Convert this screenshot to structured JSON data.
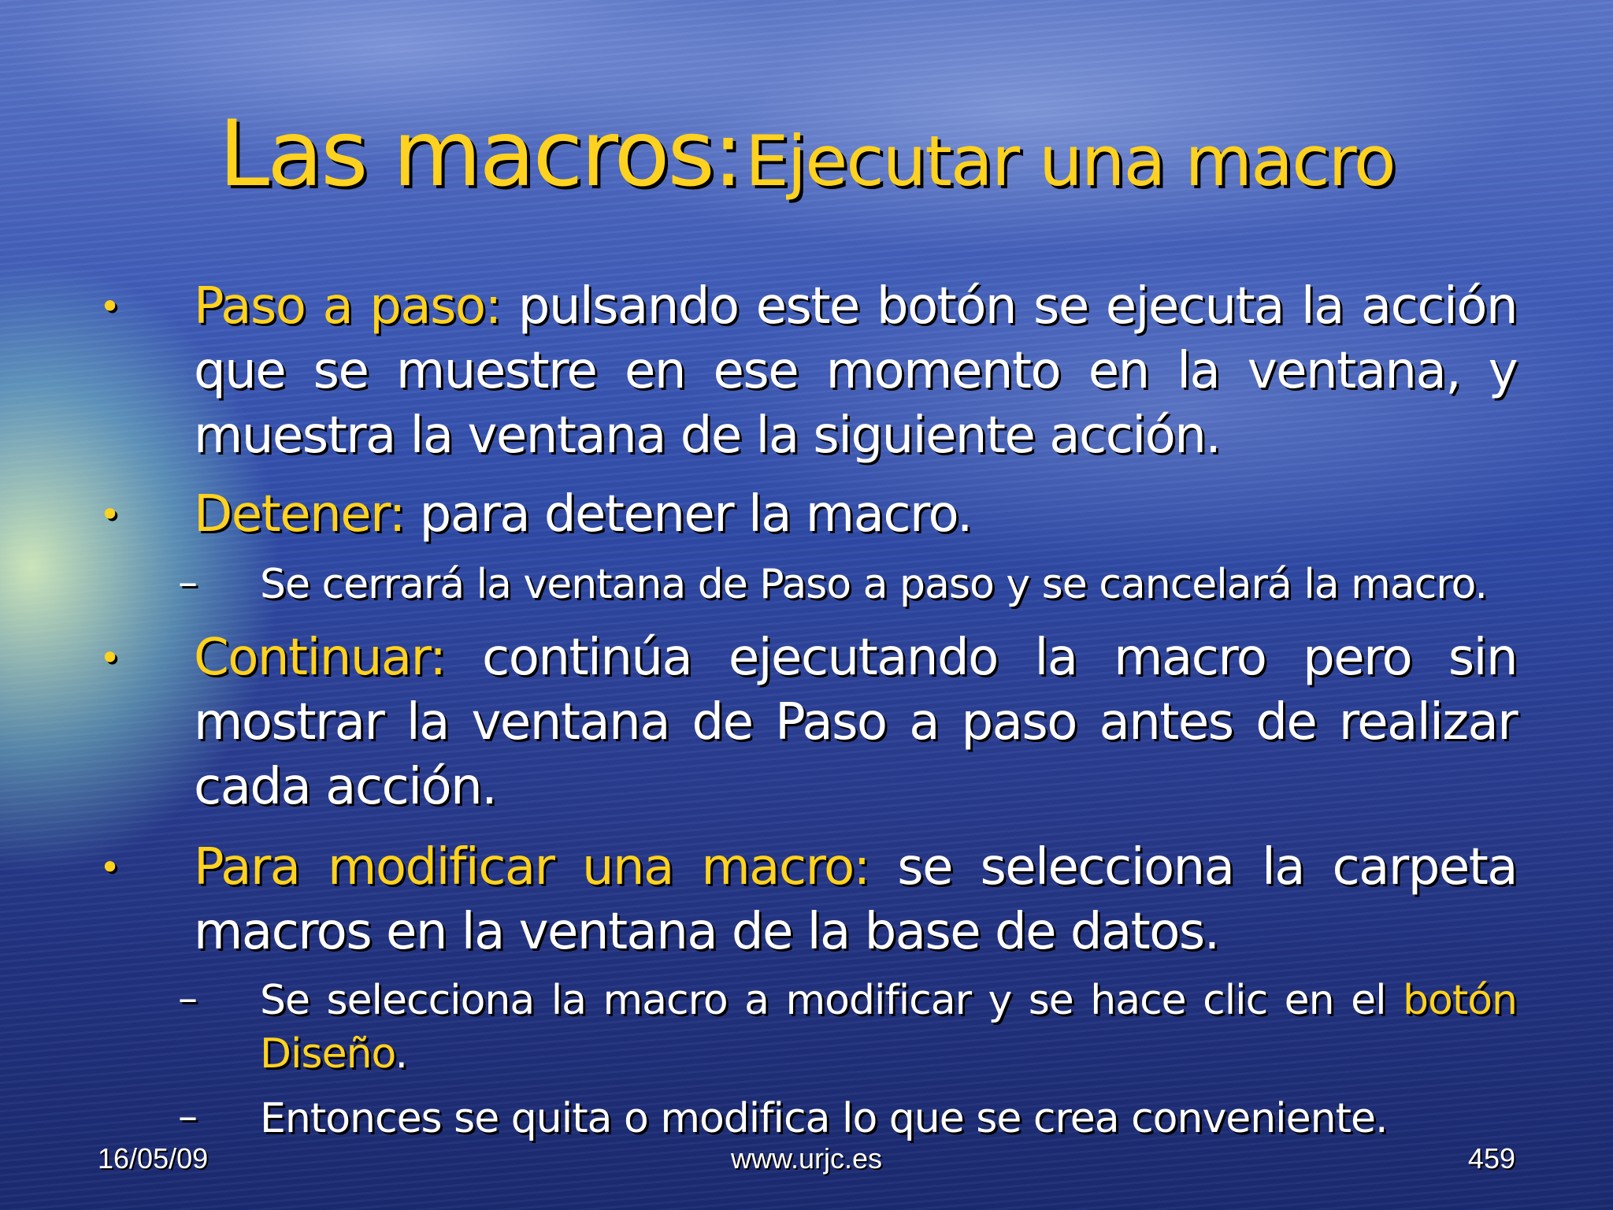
{
  "title": {
    "main": "Las macros:",
    "sub": "Ejecutar una macro"
  },
  "bullets": [
    {
      "label": "Paso a paso:",
      "text": " pulsando este botón se ejecuta la acción que se muestre en ese momento en la ventana, y muestra la ventana de la siguiente acción."
    },
    {
      "label": "Detener:",
      "text": " para detener la macro."
    },
    {
      "label": "Continuar:",
      "text": " continúa ejecutando la macro pero sin mostrar la ventana de Paso a paso antes de realizar cada acción."
    },
    {
      "label": "Para modificar una macro:",
      "text": " se selecciona la carpeta macros en la ventana de la base de datos."
    }
  ],
  "subitems": [
    {
      "text": "Se cerrará la ventana de Paso a paso y se cancelará la macro."
    },
    {
      "text": "Se selecciona la macro a modificar y se hace clic en el ",
      "highlight": "botón Diseño",
      "end": "."
    },
    {
      "text": "Entonces se quita o modifica lo que se crea conveniente."
    }
  ],
  "markers": {
    "bullet": "•",
    "dash": "–"
  },
  "footer": {
    "date": "16/05/09",
    "url": "www.urjc.es",
    "page": "459"
  },
  "colors": {
    "highlight": "#ffd21f",
    "text": "#ffffff",
    "background": "#2f4aa6"
  }
}
